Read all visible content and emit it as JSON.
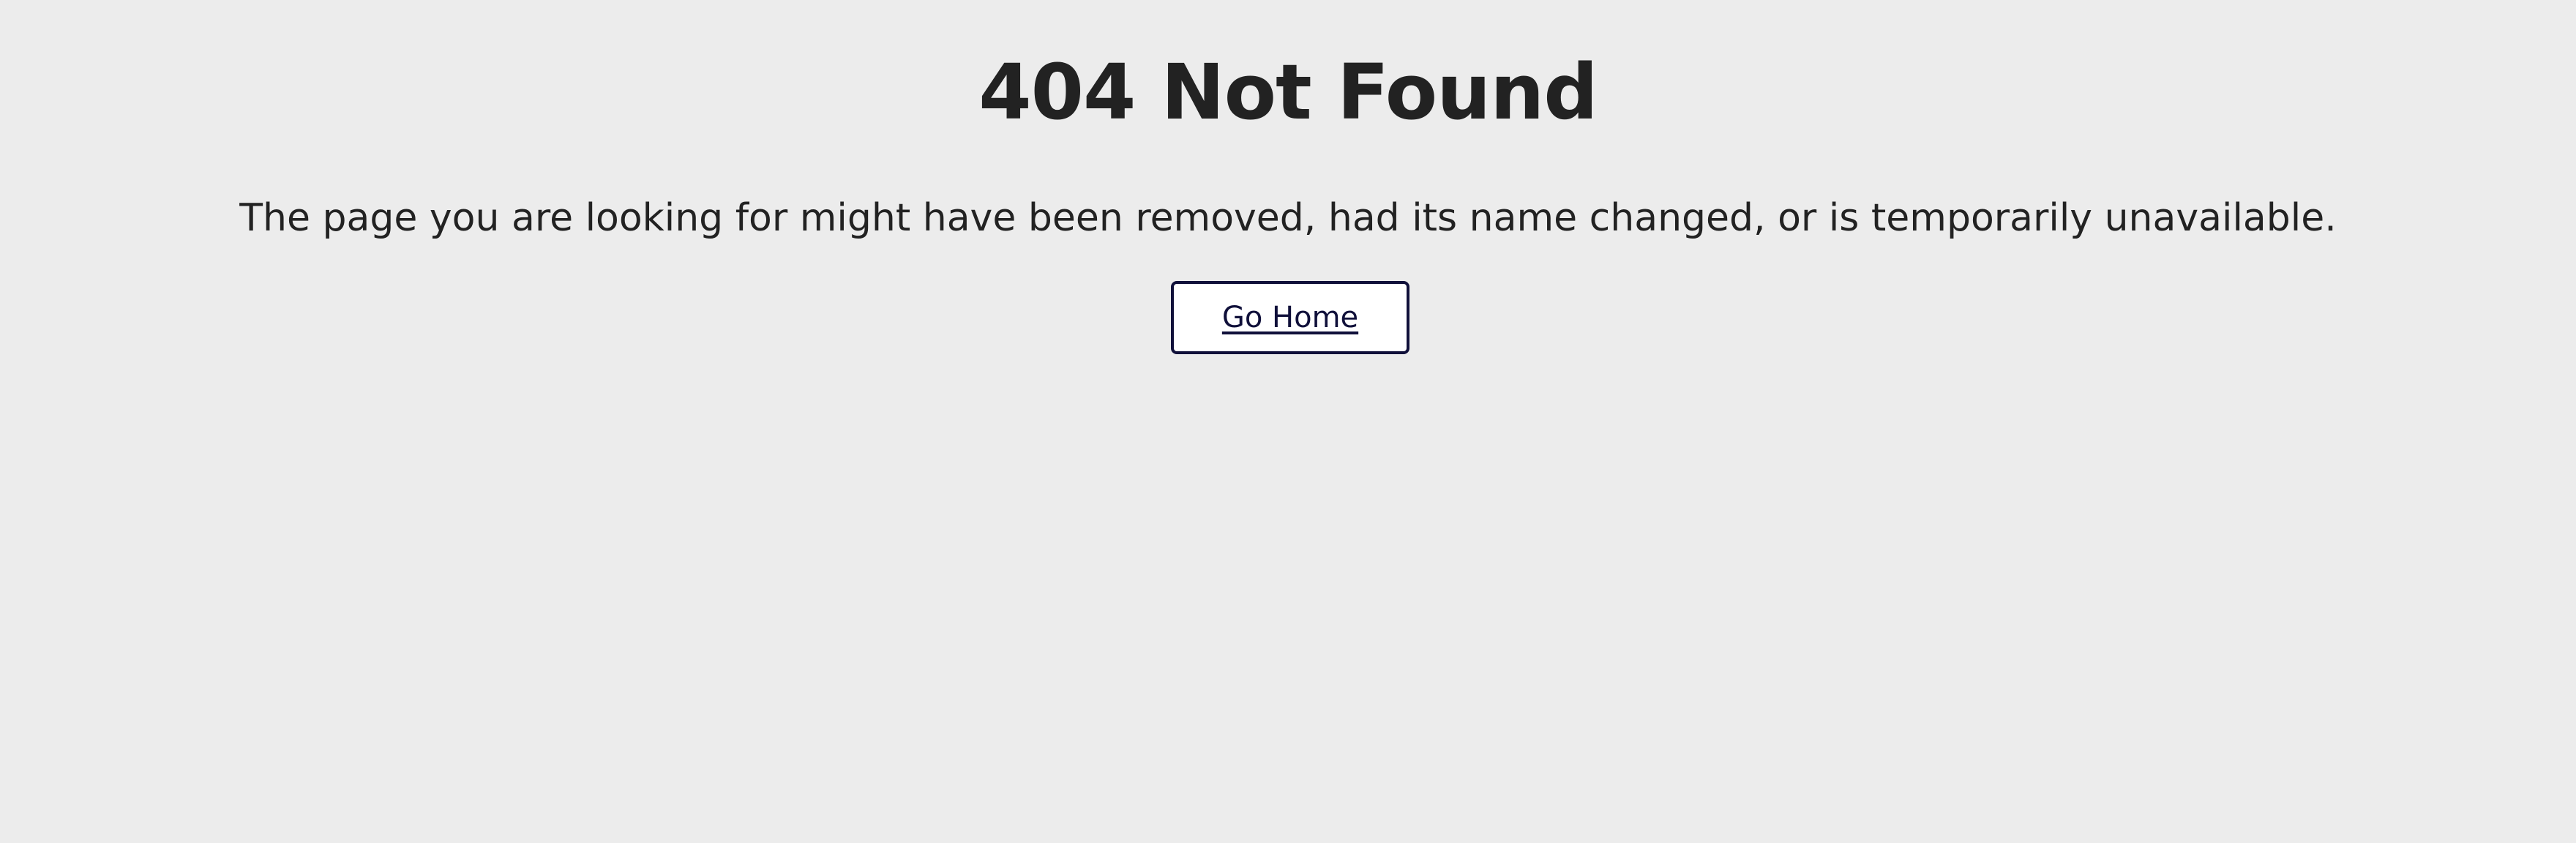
{
  "page": {
    "title": "404 Not Found",
    "message": "The page you are looking for might have been removed, had its name changed, or is temporarily unavailable.",
    "home_button_label": "Go Home"
  },
  "colors": {
    "background": "#ececec",
    "text": "#222222",
    "button_border": "#10103a",
    "button_background": "#ffffff"
  }
}
